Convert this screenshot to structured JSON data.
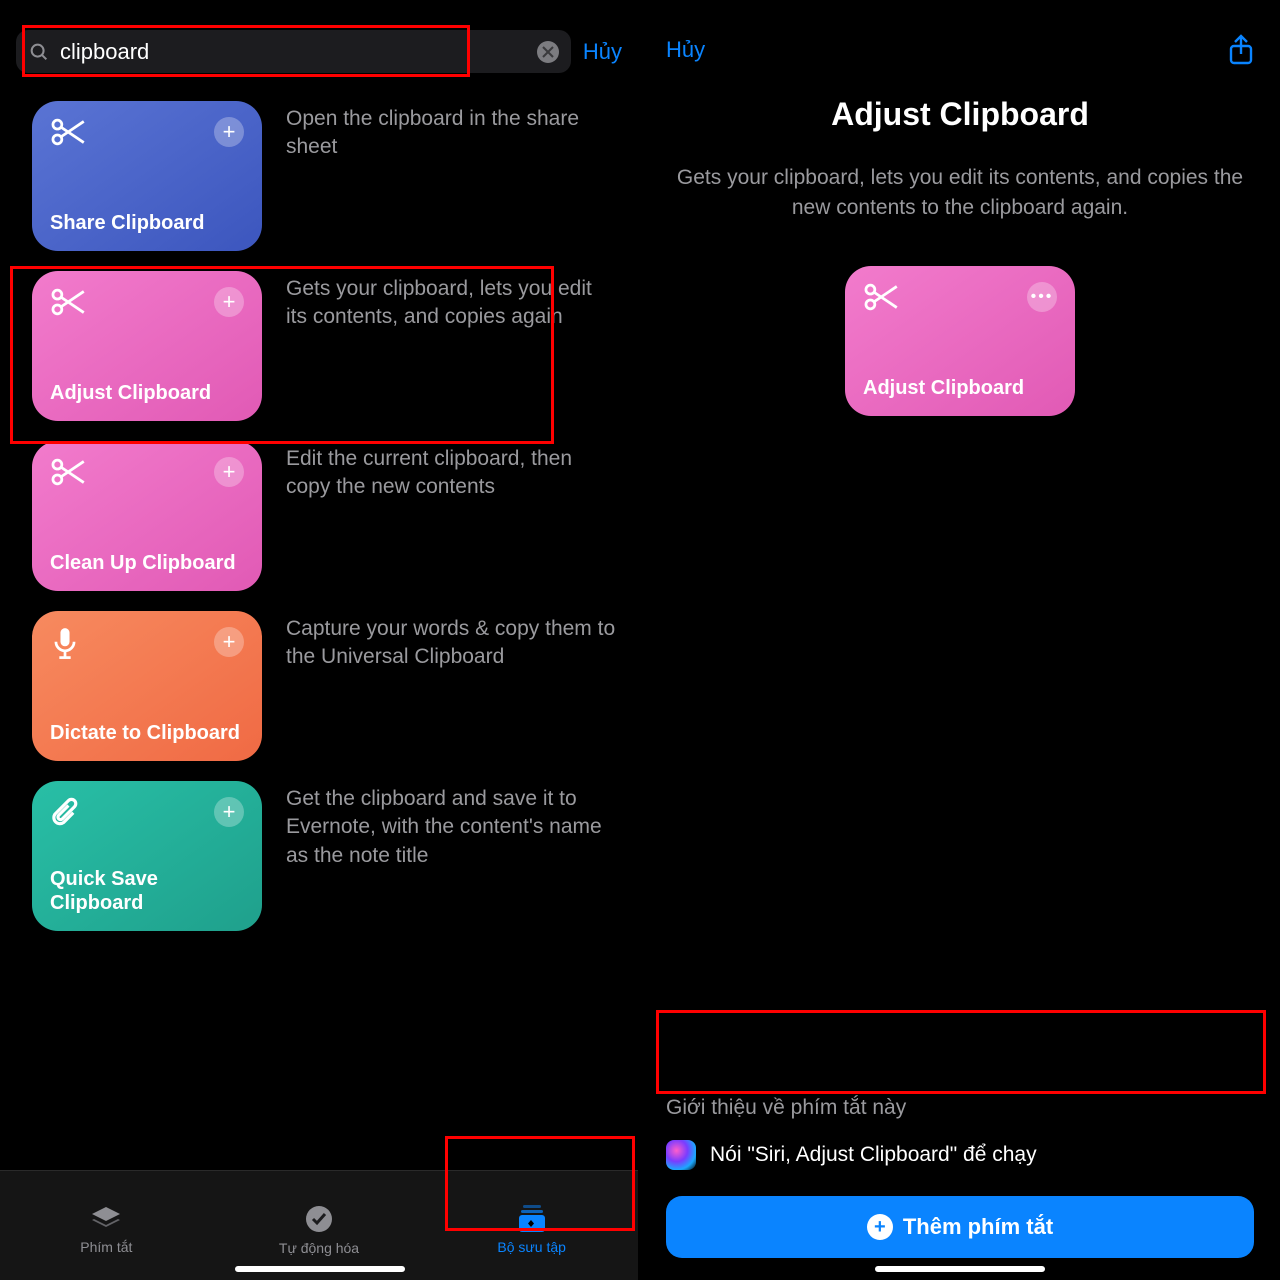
{
  "left": {
    "search": {
      "query": "clipboard"
    },
    "cancel": "Hủy",
    "results": [
      {
        "title": "Share Clipboard",
        "desc": "Open the clipboard in the share sheet",
        "color": "blue",
        "icon": "scissors"
      },
      {
        "title": "Adjust Clipboard",
        "desc": "Gets your clipboard, lets you edit its contents, and copies again",
        "color": "pink",
        "icon": "scissors"
      },
      {
        "title": "Clean Up Clipboard",
        "desc": "Edit the current clipboard, then copy the new contents",
        "color": "pink2",
        "icon": "scissors"
      },
      {
        "title": "Dictate to Clipboard",
        "desc": "Capture your words & copy them to the Universal Clipboard",
        "color": "orange",
        "icon": "mic"
      },
      {
        "title": "Quick Save Clipboard",
        "desc": "Get the clipboard and save it to Evernote, with the content's name as the note title",
        "color": "teal",
        "icon": "paperclip"
      }
    ],
    "tabs": {
      "shortcuts": "Phím tắt",
      "automation": "Tự động hóa",
      "gallery": "Bộ sưu tập"
    }
  },
  "right": {
    "cancel": "Hủy",
    "title": "Adjust Clipboard",
    "desc": "Gets your clipboard, lets you edit its contents, and copies the new contents to the clipboard again.",
    "preview_label": "Adjust Clipboard",
    "intro_label": "Giới thiệu về phím tắt này",
    "siri_text": "Nói \"Siri, Adjust Clipboard\" để chạy",
    "add_button": "Thêm phím tắt"
  },
  "colors": {
    "accent": "#0a84ff"
  }
}
